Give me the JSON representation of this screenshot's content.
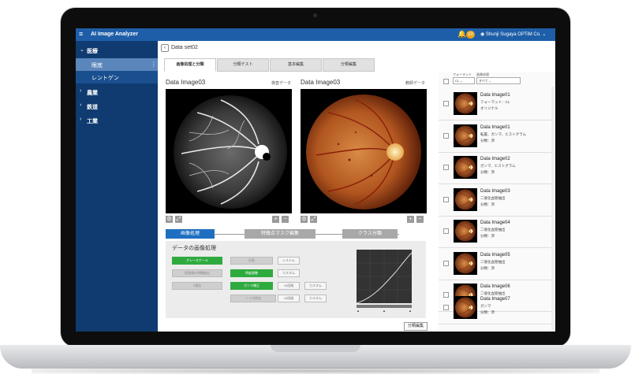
{
  "app": {
    "title": "AI Image Analyzer",
    "user": "Shunji Sugaya OPTiM Co.",
    "notification_count": "10"
  },
  "sidebar": {
    "sections": [
      {
        "label": "医療",
        "expanded": true,
        "children": [
          {
            "label": "眼底",
            "active": true
          },
          {
            "label": "レントゲン",
            "active": false
          }
        ]
      },
      {
        "label": "農業",
        "expanded": false
      },
      {
        "label": "鉄道",
        "expanded": false
      },
      {
        "label": "工業",
        "expanded": false
      }
    ]
  },
  "breadcrumb": {
    "title": "Data set02"
  },
  "tabs": [
    {
      "label": "画像処理と分類",
      "active": true
    },
    {
      "label": "分類テスト",
      "active": false
    },
    {
      "label": "基本編集",
      "active": false
    },
    {
      "label": "分類編集",
      "active": false
    }
  ],
  "left_image": {
    "title": "Data Image03",
    "side_label": "検査データ"
  },
  "right_image": {
    "title": "Data Image03",
    "side_label": "教師データ"
  },
  "steps": [
    {
      "label": "画像処理",
      "active": true
    },
    {
      "label": "特徴点マスク編集",
      "active": false
    },
    {
      "label": "クラス分類",
      "active": false
    }
  ],
  "panel": {
    "title": "データの画像処理",
    "chips": [
      "グレースケール",
      "反転",
      "システム",
      "原画像の特徴抽出",
      "明度調整",
      "カスタム",
      "2値化",
      "ガンマ補正",
      "16段階",
      "カスタム",
      "ノイズ除去",
      "16段階",
      "カスタム"
    ]
  },
  "bottom_button": "分類編集",
  "right_panel": {
    "format_label": "フォーマット",
    "process_label": "画像処理",
    "format_value": "CL",
    "process_value": "すべて",
    "items": [
      {
        "name": "Data Image01",
        "line1": "フォーマット：CL",
        "line2": "オリジナル"
      },
      {
        "name": "Data Image01",
        "line1": "転置、ガンマ、ヒストグラム",
        "line2": "分類：済"
      },
      {
        "name": "Data Image02",
        "line1": "ガンマ、ヒストグラム",
        "line2": "分類：済"
      },
      {
        "name": "Data Image03",
        "line1": "二値化血管抽出",
        "line2": "分類：済"
      },
      {
        "name": "Data Image04",
        "line1": "二値化血管抽出",
        "line2": "分類：済"
      },
      {
        "name": "Data Image05",
        "line1": "二値化血管抽出",
        "line2": "分類：済"
      },
      {
        "name": "Data Image06",
        "line1": "二値化血管抽出",
        "line2": ""
      },
      {
        "name": "Data Image07",
        "line1": "ガンマ",
        "line2": "分類：済"
      }
    ]
  },
  "colors": {
    "topbar": "#1e5ea8",
    "sidebar": "#0f3b70",
    "accent_blue": "#1e6fc0",
    "accent_green": "#2faa3f"
  },
  "icons": [
    "menu-icon",
    "bell-icon",
    "user-icon",
    "chevron-icon",
    "back-icon",
    "gear-icon",
    "zoom-in-icon",
    "zoom-out-icon"
  ]
}
